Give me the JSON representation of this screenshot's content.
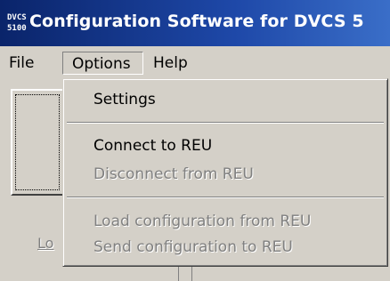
{
  "window": {
    "icon_line1": "DVCS",
    "icon_line2": "5100",
    "title": "Configuration Software for DVCS 5"
  },
  "menubar": {
    "file": "File",
    "options": "Options",
    "help": "Help"
  },
  "options_menu": {
    "settings": "Settings",
    "connect": "Connect to REU",
    "disconnect": "Disconnect from REU",
    "load": "Load configuration from REU",
    "send": "Send configuration to REU"
  },
  "background": {
    "load_label": "Lo"
  }
}
